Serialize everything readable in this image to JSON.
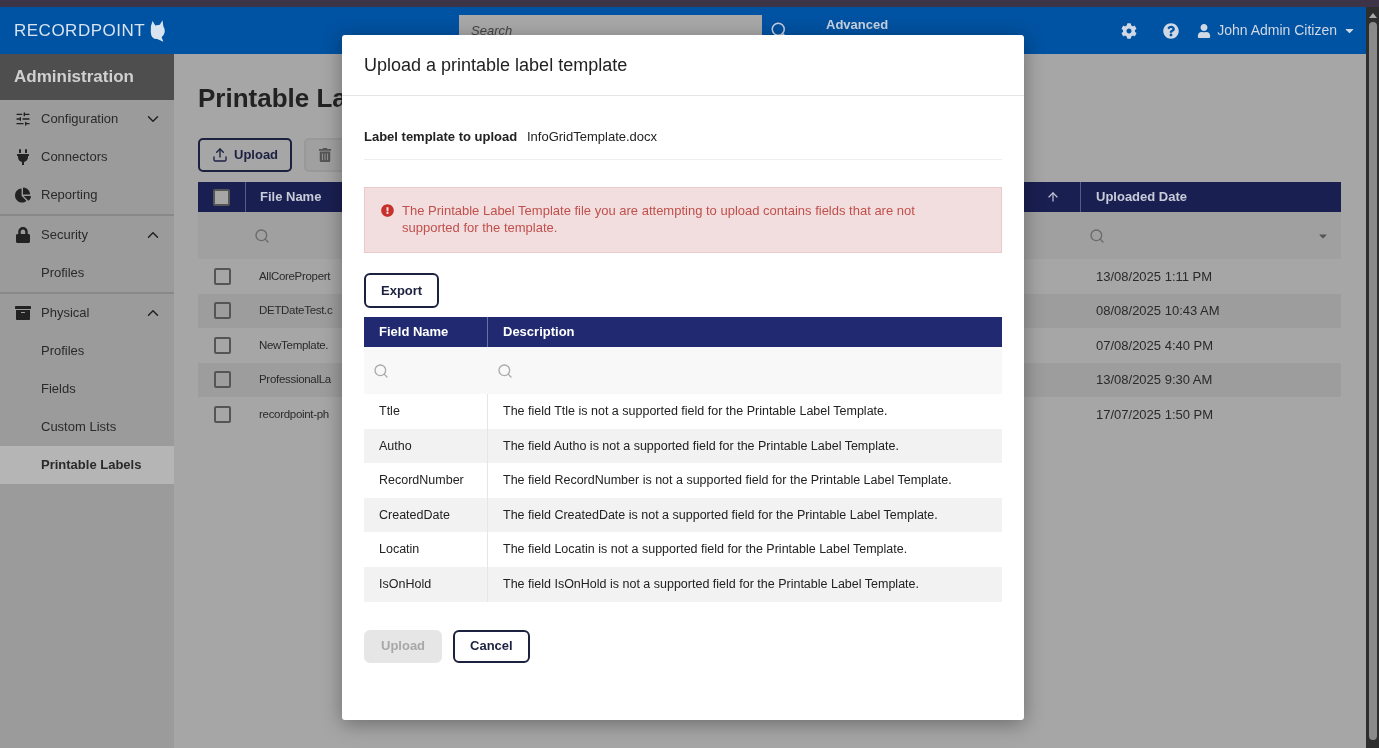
{
  "header": {
    "logo_text": "RECORDPOINT",
    "search": {
      "placeholder": "Search"
    },
    "advanced_link": "Advanced",
    "user_name": "John Admin Citizen"
  },
  "sidebar": {
    "title": "Administration",
    "items": [
      {
        "label": "Configuration",
        "selected": false,
        "expanded": false
      },
      {
        "label": "Connectors",
        "selected": false
      },
      {
        "label": "Reporting",
        "selected": false
      },
      {
        "label": "Security",
        "selected": false,
        "expanded": true,
        "children": [
          {
            "label": "Profiles",
            "selected": false
          }
        ]
      },
      {
        "label": "Physical",
        "selected": false,
        "expanded": true,
        "children": [
          {
            "label": "Profiles",
            "selected": false
          },
          {
            "label": "Fields",
            "selected": false
          },
          {
            "label": "Custom Lists",
            "selected": false
          },
          {
            "label": "Printable Labels",
            "selected": true
          }
        ]
      }
    ]
  },
  "page": {
    "title": "Printable La",
    "upload_button": "Upload",
    "table": {
      "columns": [
        "File Name",
        "Uploaded Date"
      ],
      "select_all_checked": false,
      "rows": [
        {
          "file_name": "AllCorePropert",
          "uploaded_date": "13/08/2025 1:11 PM",
          "checked": false
        },
        {
          "file_name": "DETDateTest.c",
          "uploaded_date": "08/08/2025 10:43 AM",
          "checked": false
        },
        {
          "file_name": "NewTemplate.",
          "uploaded_date": "07/08/2025 4:40 PM",
          "checked": false
        },
        {
          "file_name": "ProfessionalLa",
          "uploaded_date": "13/08/2025 9:30 AM",
          "checked": false
        },
        {
          "file_name": "recordpoint-ph",
          "uploaded_date": "17/07/2025 1:50 PM",
          "checked": false
        }
      ]
    }
  },
  "modal": {
    "title": "Upload a printable label template",
    "field_label": "Label template to upload",
    "field_value": "InfoGridTemplate.docx",
    "error": "The Printable Label Template file you are attempting to upload contains fields that are not supported for the template.",
    "export_button": "Export",
    "table": {
      "columns": [
        "Field Name",
        "Description"
      ],
      "rows": [
        {
          "field_name": "Ttle",
          "description": "The field Ttle is not a supported field for the Printable Label Template."
        },
        {
          "field_name": "Autho",
          "description": "The field Autho is not a supported field for the Printable Label Template."
        },
        {
          "field_name": "RecordNumber",
          "description": "The field RecordNumber is not a supported field for the Printable Label Template."
        },
        {
          "field_name": "CreatedDate",
          "description": "The field CreatedDate is not a supported field for the Printable Label Template."
        },
        {
          "field_name": "Locatin",
          "description": "The field Locatin is not a supported field for the Printable Label Template."
        },
        {
          "field_name": "IsOnHold",
          "description": "The field IsOnHold is not a supported field for the Printable Label Template."
        }
      ]
    },
    "buttons": [
      {
        "label": "Upload",
        "disabled": true
      },
      {
        "label": "Cancel",
        "disabled": false
      }
    ]
  }
}
